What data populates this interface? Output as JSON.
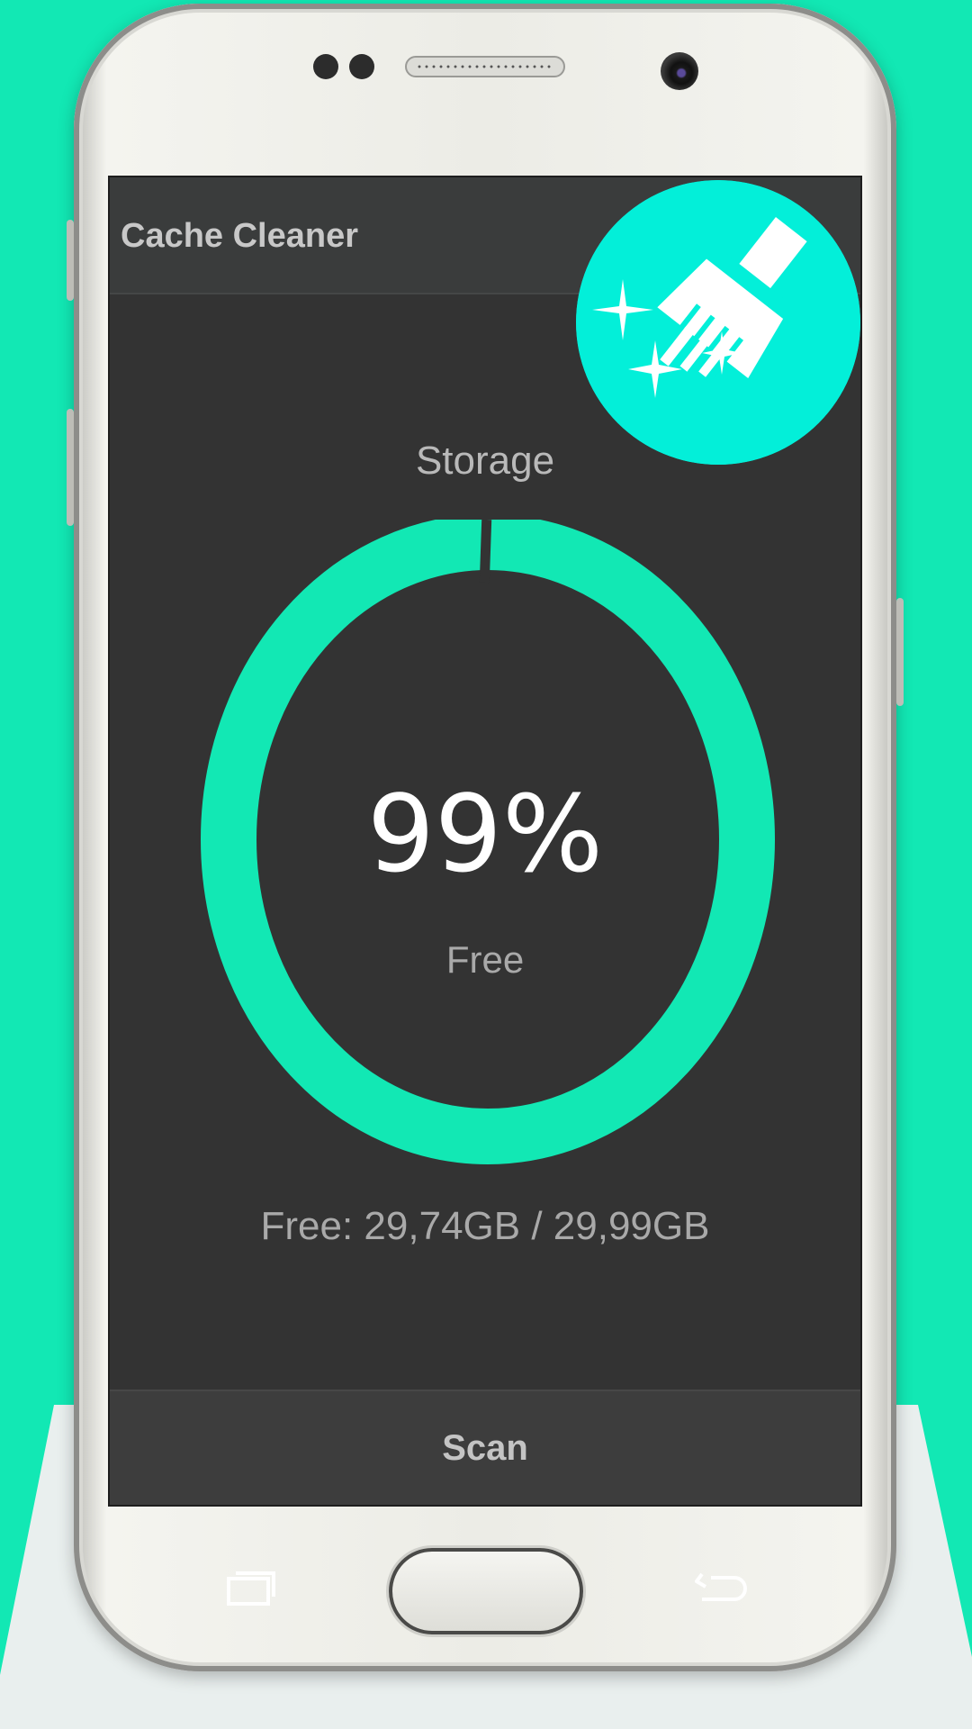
{
  "app": {
    "title": "Cache Cleaner"
  },
  "storage": {
    "label": "Storage",
    "percent_text": "99%",
    "percent_value": 99,
    "free_label": "Free",
    "detail": "Free: 29,74GB / 29,99GB"
  },
  "actions": {
    "scan_label": "Scan"
  },
  "colors": {
    "background": "#12e8b4",
    "ring": "#12e8b4",
    "screen": "#333333",
    "badge": "#03efd9"
  },
  "icons": {
    "badge": "broom-sparkle-icon",
    "recent_apps": "recent-apps-icon",
    "back": "back-arrow-icon"
  }
}
